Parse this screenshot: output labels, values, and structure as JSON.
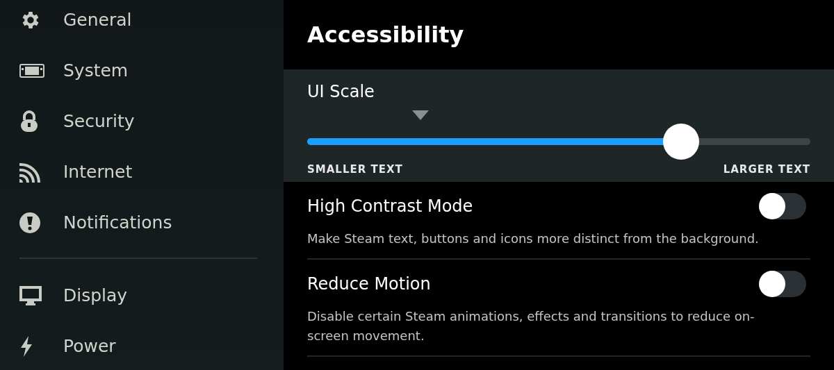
{
  "sidebar": {
    "groups": [
      [
        {
          "label": "General"
        },
        {
          "label": "System"
        },
        {
          "label": "Security"
        },
        {
          "label": "Internet"
        },
        {
          "label": "Notifications"
        }
      ],
      [
        {
          "label": "Display"
        },
        {
          "label": "Power"
        }
      ]
    ]
  },
  "page": {
    "title": "Accessibility",
    "ui_scale": {
      "label": "UI Scale",
      "level": 0.743,
      "min_label": "SMALLER TEXT",
      "max_label": "LARGER TEXT"
    },
    "toggles": [
      {
        "label": "High Contrast Mode",
        "description": "Make Steam text, buttons and icons more distinct from the background.",
        "on": false
      },
      {
        "label": "Reduce Motion",
        "description": "Disable certain Steam animations, effects and transitions to reduce on-screen movement.",
        "on": false
      }
    ]
  }
}
